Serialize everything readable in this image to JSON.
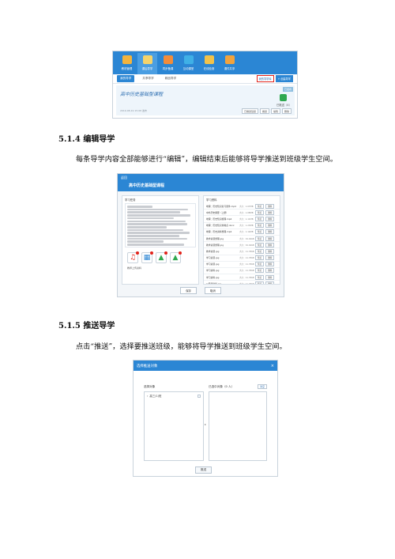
{
  "screenshot1": {
    "nav": [
      {
        "label": "教材管理",
        "icon": "folder-icon",
        "color": "#f2b33d"
      },
      {
        "label": "课后导学",
        "icon": "notebook-icon",
        "color": "#f5d36b"
      },
      {
        "label": "同步备课",
        "icon": "book-icon",
        "color": "#f28c3a"
      },
      {
        "label": "互动课堂",
        "icon": "board-icon",
        "color": "#3fb0e6"
      },
      {
        "label": "在线检测",
        "icon": "check-icon",
        "color": "#f2c24a"
      },
      {
        "label": "课件共享",
        "icon": "briefcase-icon",
        "color": "#f2a33d"
      }
    ],
    "tabs": [
      "我的导学",
      "共享导学",
      "精品导学"
    ],
    "top_buttons": {
      "highlighted": "我的导学库",
      "create": "+ 创建导学"
    },
    "card": {
      "title": "高中历史基础型课程",
      "date": "2019-08-19 15:08 发布",
      "status": "已发布",
      "sent": "已推送（4）",
      "buttons": [
        "已推送班级",
        "推送",
        "编辑",
        "删除"
      ]
    }
  },
  "section_edit": {
    "heading": "5.1.4 编辑导学",
    "paragraph": "每条导学内容全部能够进行“编辑”，编辑结束后能够将导学推送到班级学生空间。"
  },
  "screenshot2": {
    "back": "返回",
    "title": "高中历史基础型课程",
    "left_title": "学习任务",
    "media_caption": "教师上传资料",
    "right_title": "学习资料",
    "files": [
      {
        "name": "地理：历史知识复习课件.mp4",
        "size": "大小：1.07MB"
      },
      {
        "name": "中外历史纲要（上册）",
        "size": "大小：1.08MB"
      },
      {
        "name": "地理：历史知识梳理.mp4",
        "size": "大小：1.11MB"
      },
      {
        "name": "地理：历史知识重难点.docx",
        "size": "大小：1.23MB"
      },
      {
        "name": "地理：历史资料整理.mp4",
        "size": "大小：1.14MB"
      },
      {
        "name": "教学资源整理.jpg",
        "size": "大小：32.49KB"
      },
      {
        "name": "教学资源整理.jpg",
        "size": "大小：32.49KB"
      },
      {
        "name": "教学资源.jpg",
        "size": "大小：11.78KB"
      },
      {
        "name": "学习资源.jpg",
        "size": "大小：11.78KB"
      },
      {
        "name": "学习资源.jpg",
        "size": "大小：11.78KB"
      },
      {
        "name": "学习资料.jpg",
        "size": "大小：11.78KB"
      },
      {
        "name": "学习资料.jpg",
        "size": "大小：11.78KB"
      },
      {
        "name": "公开课资料.jpg",
        "size": "大小：11.78KB"
      }
    ],
    "file_btn_preview": "预览",
    "file_btn_delete": "删除",
    "footer": [
      "保存",
      "取消"
    ]
  },
  "section_push": {
    "heading": "5.1.5 推送导学",
    "paragraph": "点击“推送”，选择要推送班级，能够将导学推送到班级学生空间。"
  },
  "screenshot3": {
    "title": "选择推送对象",
    "close": "×",
    "left_label": "选择对象",
    "class_item": "高三(1)班",
    "right_label": "已选中对象（0 人）",
    "clear": "清空",
    "confirm": "推送"
  }
}
